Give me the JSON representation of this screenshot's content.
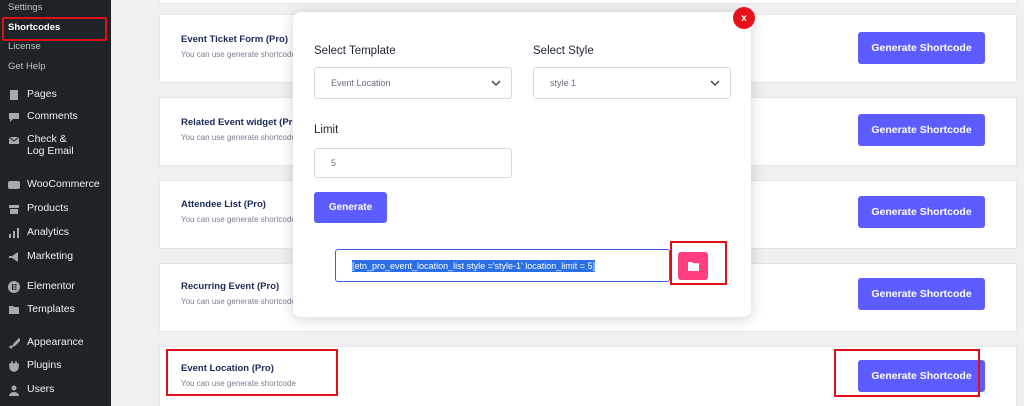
{
  "sidebar": {
    "sub_items": [
      {
        "label": "Settings"
      },
      {
        "label": "Shortcodes"
      },
      {
        "label": "License"
      },
      {
        "label": "Get Help"
      }
    ],
    "menu": [
      {
        "label": "Pages",
        "icon": "pages-icon"
      },
      {
        "label": "Comments",
        "icon": "comments-icon"
      },
      {
        "label": "Check & Log Email",
        "icon": "email-icon"
      },
      {
        "label": "WooCommerce",
        "icon": "woocommerce-icon"
      },
      {
        "label": "Products",
        "icon": "products-icon"
      },
      {
        "label": "Analytics",
        "icon": "analytics-icon"
      },
      {
        "label": "Marketing",
        "icon": "marketing-icon"
      },
      {
        "label": "Elementor",
        "icon": "elementor-icon"
      },
      {
        "label": "Templates",
        "icon": "templates-icon"
      },
      {
        "label": "Appearance",
        "icon": "appearance-icon"
      },
      {
        "label": "Plugins",
        "icon": "plugins-icon"
      },
      {
        "label": "Users",
        "icon": "users-icon"
      }
    ]
  },
  "cards": [
    {
      "title": "Event Ticket Form (Pro)",
      "desc": "You can use generate shortcode",
      "button": "Generate Shortcode"
    },
    {
      "title": "Related Event widget (Pro)",
      "desc": "You can use generate shortcode",
      "button": "Generate Shortcode"
    },
    {
      "title": "Attendee List (Pro)",
      "desc": "You can use generate shortcode",
      "button": "Generate Shortcode"
    },
    {
      "title": "Recurring Event (Pro)",
      "desc": "You can use generate shortcode",
      "button": "Generate Shortcode"
    },
    {
      "title": "Event Location (Pro)",
      "desc": "You can use generate shortcode",
      "button": "Generate Shortcode"
    }
  ],
  "modal": {
    "close_label": "x",
    "select_template_label": "Select Template",
    "template_value": "Event Location",
    "select_style_label": "Select Style",
    "style_value": "style 1",
    "limit_label": "Limit",
    "limit_value": "5",
    "generate_label": "Generate",
    "shortcode": "[etn_pro_event_location_list style ='style-1' location_limit = 5]"
  },
  "colors": {
    "primary": "#5d5dff",
    "copy_button": "#ff3d7f",
    "close_button": "#e8101a",
    "highlight": "#e0101a",
    "sidebar_bg": "#1d2327"
  }
}
